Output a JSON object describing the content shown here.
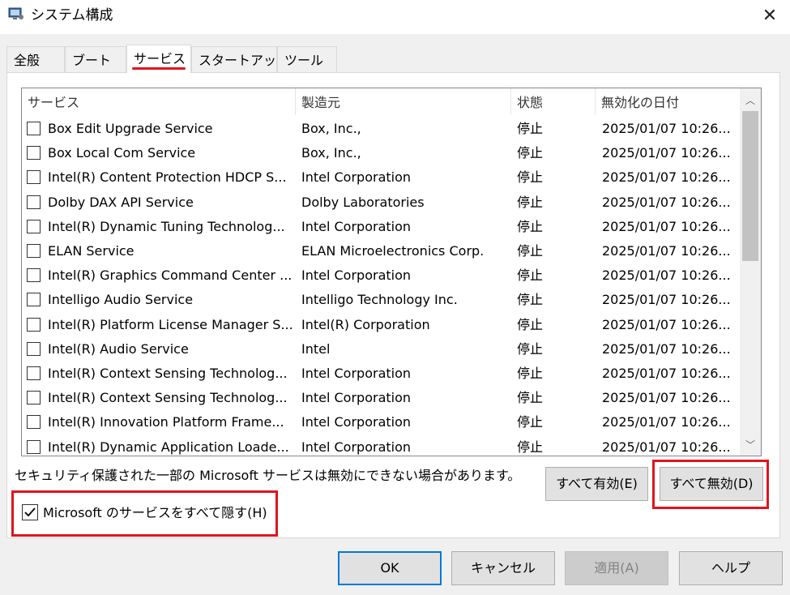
{
  "window": {
    "title": "システム構成",
    "close_glyph": "✕",
    "icon": "msconfig-icon"
  },
  "tabs": [
    {
      "label": "全般"
    },
    {
      "label": "ブート"
    },
    {
      "label": "サービス",
      "active": true
    },
    {
      "label": "スタートアップ"
    },
    {
      "label": "ツール"
    }
  ],
  "columns": [
    "サービス",
    "製造元",
    "状態",
    "無効化の日付"
  ],
  "services": [
    {
      "name": "Box Edit Upgrade Service",
      "maker": "Box, Inc.,",
      "status": "停止",
      "date": "2025/01/07 10:26..."
    },
    {
      "name": "Box Local Com Service",
      "maker": "Box, Inc.,",
      "status": "停止",
      "date": "2025/01/07 10:26..."
    },
    {
      "name": "Intel(R) Content Protection HDCP S...",
      "maker": "Intel Corporation",
      "status": "停止",
      "date": "2025/01/07 10:26..."
    },
    {
      "name": "Dolby DAX API Service",
      "maker": "Dolby Laboratories",
      "status": "停止",
      "date": "2025/01/07 10:26..."
    },
    {
      "name": "Intel(R) Dynamic Tuning Technolog...",
      "maker": "Intel Corporation",
      "status": "停止",
      "date": "2025/01/07 10:26..."
    },
    {
      "name": "ELAN Service",
      "maker": "ELAN Microelectronics Corp.",
      "status": "停止",
      "date": "2025/01/07 10:26..."
    },
    {
      "name": "Intel(R) Graphics Command Center ...",
      "maker": "Intel Corporation",
      "status": "停止",
      "date": "2025/01/07 10:26..."
    },
    {
      "name": "Intelligo Audio Service",
      "maker": "Intelligo Technology Inc.",
      "status": "停止",
      "date": "2025/01/07 10:26..."
    },
    {
      "name": "Intel(R) Platform License Manager S...",
      "maker": "Intel(R) Corporation",
      "status": "停止",
      "date": "2025/01/07 10:26..."
    },
    {
      "name": "Intel(R) Audio Service",
      "maker": "Intel",
      "status": "停止",
      "date": "2025/01/07 10:26..."
    },
    {
      "name": "Intel(R) Context Sensing Technolog...",
      "maker": "Intel Corporation",
      "status": "停止",
      "date": "2025/01/07 10:26..."
    },
    {
      "name": "Intel(R) Context Sensing Technolog...",
      "maker": "Intel Corporation",
      "status": "停止",
      "date": "2025/01/07 10:26..."
    },
    {
      "name": "Intel(R) Innovation Platform Frame...",
      "maker": "Intel Corporation",
      "status": "停止",
      "date": "2025/01/07 10:26..."
    },
    {
      "name": "Intel(R) Dynamic Application Loade...",
      "maker": "Intel Corporation",
      "status": "停止",
      "date": "2025/01/07 10:26..."
    }
  ],
  "scroll": {
    "up": "︿",
    "down": "﹀"
  },
  "note": "セキュリティ保護された一部の Microsoft サービスは無効にできない場合があります。",
  "buttons": {
    "enable_all": "すべて有効(E)",
    "disable_all": "すべて無効(D)",
    "ok": "OK",
    "cancel": "キャンセル",
    "apply": "適用(A)",
    "help": "ヘルプ"
  },
  "hide_ms": {
    "label": "Microsoft のサービスをすべて隠す(H)",
    "checked": true,
    "check_glyph": "✓"
  },
  "colors": {
    "highlight": "#e0141e",
    "default_button_border": "#0078d7"
  }
}
